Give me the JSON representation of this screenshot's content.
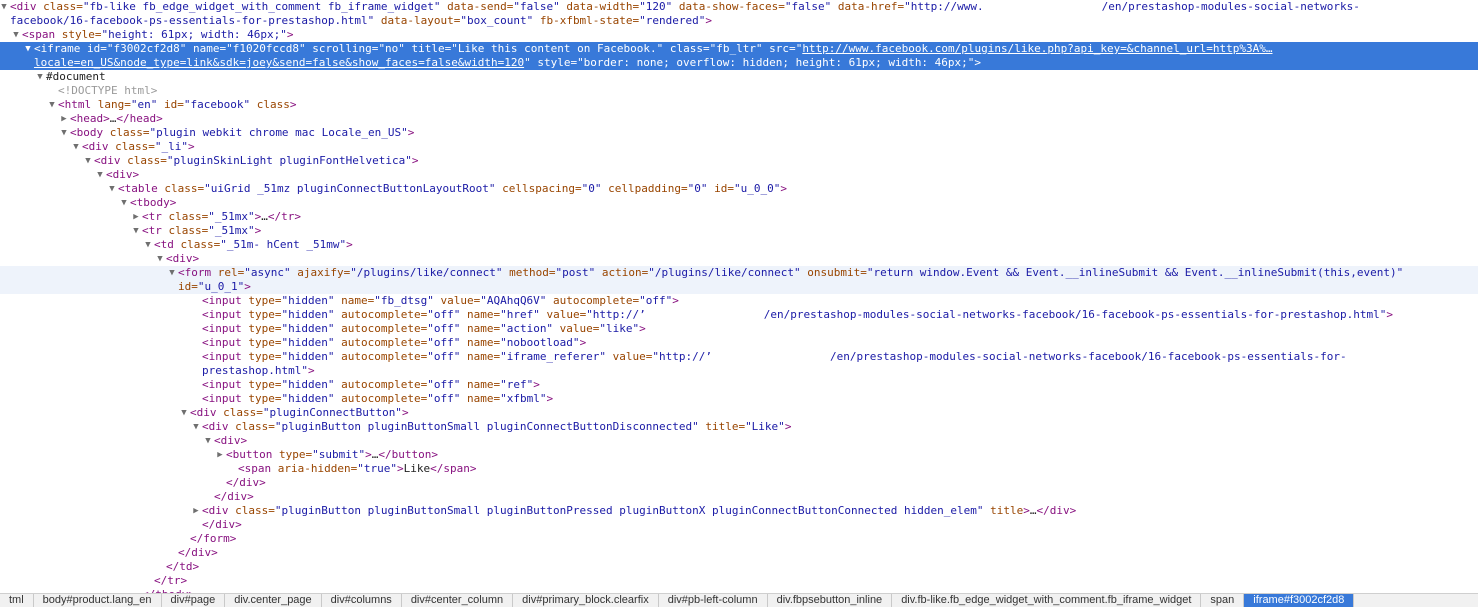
{
  "tree": [
    {
      "depth": 0,
      "tri": "▼",
      "wrap": true,
      "parts": [
        {
          "t": "<",
          "c": "tn"
        },
        {
          "t": "div",
          "c": "tn"
        },
        {
          "t": " class=",
          "c": "an"
        },
        {
          "t": "\"fb-like fb_edge_widget_with_comment fb_iframe_widget\"",
          "c": "av"
        },
        {
          "t": " data-send=",
          "c": "an"
        },
        {
          "t": "\"false\"",
          "c": "av"
        },
        {
          "t": " data-width=",
          "c": "an"
        },
        {
          "t": "\"120\"",
          "c": "av"
        },
        {
          "t": " data-show-faces=",
          "c": "an"
        },
        {
          "t": "\"false\"",
          "c": "av"
        },
        {
          "t": " data-href=",
          "c": "an"
        },
        {
          "t": "\"http://www.",
          "c": "av"
        },
        {
          "gap": 1
        },
        {
          "t": "/en/prestashop-modules-social-networks-facebook/16-facebook-ps-essentials-for-prestashop.html\"",
          "c": "av"
        },
        {
          "t": " data-layout=",
          "c": "an"
        },
        {
          "t": "\"box_count\"",
          "c": "av"
        },
        {
          "t": " fb-xfbml-state=",
          "c": "an"
        },
        {
          "t": "\"rendered\"",
          "c": "av"
        },
        {
          "t": ">",
          "c": "tn"
        }
      ]
    },
    {
      "depth": 1,
      "tri": "▼",
      "parts": [
        {
          "t": "<span",
          "c": "tn"
        },
        {
          "t": " style=",
          "c": "an"
        },
        {
          "t": "\"height: 61px; width: 46px;\"",
          "c": "av"
        },
        {
          "t": ">",
          "c": "tn"
        }
      ]
    },
    {
      "depth": 2,
      "tri": "▼",
      "selected": true,
      "wrap": true,
      "parts": [
        {
          "t": "<iframe",
          "c": "tn"
        },
        {
          "t": " id=",
          "c": "an"
        },
        {
          "t": "\"f3002cf2d8\"",
          "c": "av"
        },
        {
          "t": " name=",
          "c": "an"
        },
        {
          "t": "\"f1020fccd8\"",
          "c": "av"
        },
        {
          "t": " scrolling=",
          "c": "an"
        },
        {
          "t": "\"no\"",
          "c": "av"
        },
        {
          "t": " title=",
          "c": "an"
        },
        {
          "t": "\"Like this content on Facebook.\"",
          "c": "av"
        },
        {
          "t": " class=",
          "c": "an"
        },
        {
          "t": "\"fb_ltr\"",
          "c": "av"
        },
        {
          "t": " src=",
          "c": "an"
        },
        {
          "t": "\"",
          "c": "av"
        },
        {
          "t": "http://www.facebook.com/plugins/like.php?api_key=&channel_url=http%3A%… locale=en_US&node_type=link&sdk=joey&send=false&show_faces=false&width=120",
          "c": "av lnk"
        },
        {
          "t": "\"",
          "c": "av"
        },
        {
          "t": " style=",
          "c": "an"
        },
        {
          "t": "\"border: none; overflow: hidden; height: 61px; width: 46px;\"",
          "c": "av"
        },
        {
          "t": ">",
          "c": "tn"
        }
      ]
    },
    {
      "depth": 3,
      "tri": "▼",
      "parts": [
        {
          "t": "#document",
          "c": "tx"
        }
      ]
    },
    {
      "depth": 4,
      "tri": "",
      "parts": [
        {
          "t": "<!DOCTYPE html>",
          "c": "cm"
        }
      ]
    },
    {
      "depth": 4,
      "tri": "▼",
      "parts": [
        {
          "t": "<html",
          "c": "tn"
        },
        {
          "t": " lang=",
          "c": "an"
        },
        {
          "t": "\"en\"",
          "c": "av"
        },
        {
          "t": " id=",
          "c": "an"
        },
        {
          "t": "\"facebook\"",
          "c": "av"
        },
        {
          "t": " class",
          "c": "an"
        },
        {
          "t": ">",
          "c": "tn"
        }
      ]
    },
    {
      "depth": 5,
      "tri": "▶",
      "parts": [
        {
          "t": "<head>",
          "c": "tn"
        },
        {
          "t": "…",
          "c": "tx"
        },
        {
          "t": "</head>",
          "c": "tn"
        }
      ]
    },
    {
      "depth": 5,
      "tri": "▼",
      "parts": [
        {
          "t": "<body",
          "c": "tn"
        },
        {
          "t": " class=",
          "c": "an"
        },
        {
          "t": "\"plugin webkit chrome mac Locale_en_US\"",
          "c": "av"
        },
        {
          "t": ">",
          "c": "tn"
        }
      ]
    },
    {
      "depth": 6,
      "tri": "▼",
      "parts": [
        {
          "t": "<div",
          "c": "tn"
        },
        {
          "t": " class=",
          "c": "an"
        },
        {
          "t": "\"_li\"",
          "c": "av"
        },
        {
          "t": ">",
          "c": "tn"
        }
      ]
    },
    {
      "depth": 7,
      "tri": "▼",
      "parts": [
        {
          "t": "<div",
          "c": "tn"
        },
        {
          "t": " class=",
          "c": "an"
        },
        {
          "t": "\"pluginSkinLight pluginFontHelvetica\"",
          "c": "av"
        },
        {
          "t": ">",
          "c": "tn"
        }
      ]
    },
    {
      "depth": 8,
      "tri": "▼",
      "parts": [
        {
          "t": "<div>",
          "c": "tn"
        }
      ]
    },
    {
      "depth": 9,
      "tri": "▼",
      "parts": [
        {
          "t": "<table",
          "c": "tn"
        },
        {
          "t": " class=",
          "c": "an"
        },
        {
          "t": "\"uiGrid _51mz pluginConnectButtonLayoutRoot\"",
          "c": "av"
        },
        {
          "t": " cellspacing=",
          "c": "an"
        },
        {
          "t": "\"0\"",
          "c": "av"
        },
        {
          "t": " cellpadding=",
          "c": "an"
        },
        {
          "t": "\"0\"",
          "c": "av"
        },
        {
          "t": " id=",
          "c": "an"
        },
        {
          "t": "\"u_0_0\"",
          "c": "av"
        },
        {
          "t": ">",
          "c": "tn"
        }
      ]
    },
    {
      "depth": 10,
      "tri": "▼",
      "parts": [
        {
          "t": "<tbody>",
          "c": "tn"
        }
      ]
    },
    {
      "depth": 11,
      "tri": "▶",
      "parts": [
        {
          "t": "<tr",
          "c": "tn"
        },
        {
          "t": " class=",
          "c": "an"
        },
        {
          "t": "\"_51mx\"",
          "c": "av"
        },
        {
          "t": ">",
          "c": "tn"
        },
        {
          "t": "…",
          "c": "tx"
        },
        {
          "t": "</tr>",
          "c": "tn"
        }
      ]
    },
    {
      "depth": 11,
      "tri": "▼",
      "parts": [
        {
          "t": "<tr",
          "c": "tn"
        },
        {
          "t": " class=",
          "c": "an"
        },
        {
          "t": "\"_51mx\"",
          "c": "av"
        },
        {
          "t": ">",
          "c": "tn"
        }
      ]
    },
    {
      "depth": 12,
      "tri": "▼",
      "parts": [
        {
          "t": "<td",
          "c": "tn"
        },
        {
          "t": " class=",
          "c": "an"
        },
        {
          "t": "\"_51m- hCent _51mw\"",
          "c": "av"
        },
        {
          "t": ">",
          "c": "tn"
        }
      ]
    },
    {
      "depth": 13,
      "tri": "▼",
      "parts": [
        {
          "t": "<div>",
          "c": "tn"
        }
      ]
    },
    {
      "depth": 14,
      "tri": "▼",
      "hover": true,
      "wrap": true,
      "parts": [
        {
          "t": "<form",
          "c": "tn"
        },
        {
          "t": " rel=",
          "c": "an"
        },
        {
          "t": "\"async\"",
          "c": "av"
        },
        {
          "t": " ajaxify=",
          "c": "an"
        },
        {
          "t": "\"/plugins/like/connect\"",
          "c": "av"
        },
        {
          "t": " method=",
          "c": "an"
        },
        {
          "t": "\"post\"",
          "c": "av"
        },
        {
          "t": " action=",
          "c": "an"
        },
        {
          "t": "\"/plugins/like/connect\"",
          "c": "av"
        },
        {
          "t": " onsubmit=",
          "c": "an"
        },
        {
          "t": "\"return window.Event && Event.__inlineSubmit && Event.__inlineSubmit(this,event)\"",
          "c": "av"
        },
        {
          "t": " id=",
          "c": "an"
        },
        {
          "t": "\"u_0_1\"",
          "c": "av"
        },
        {
          "t": ">",
          "c": "tn"
        }
      ]
    },
    {
      "depth": 16,
      "tri": "",
      "parts": [
        {
          "t": "<input",
          "c": "tn"
        },
        {
          "t": " type=",
          "c": "an"
        },
        {
          "t": "\"hidden\"",
          "c": "av"
        },
        {
          "t": " name=",
          "c": "an"
        },
        {
          "t": "\"fb_dtsg\"",
          "c": "av"
        },
        {
          "t": " value=",
          "c": "an"
        },
        {
          "t": "\"AQAhqQ6V\"",
          "c": "av"
        },
        {
          "t": " autocomplete=",
          "c": "an"
        },
        {
          "t": "\"off\"",
          "c": "av"
        },
        {
          "t": ">",
          "c": "tn"
        }
      ]
    },
    {
      "depth": 16,
      "tri": "",
      "parts": [
        {
          "t": "<input",
          "c": "tn"
        },
        {
          "t": " type=",
          "c": "an"
        },
        {
          "t": "\"hidden\"",
          "c": "av"
        },
        {
          "t": " autocomplete=",
          "c": "an"
        },
        {
          "t": "\"off\"",
          "c": "av"
        },
        {
          "t": " name=",
          "c": "an"
        },
        {
          "t": "\"href\"",
          "c": "av"
        },
        {
          "t": " value=",
          "c": "an"
        },
        {
          "t": "\"http://’",
          "c": "av"
        },
        {
          "gap": 1
        },
        {
          "t": "/en/prestashop-modules-social-networks-facebook/16-facebook-ps-essentials-for-prestashop.html\"",
          "c": "av"
        },
        {
          "t": ">",
          "c": "tn"
        }
      ]
    },
    {
      "depth": 16,
      "tri": "",
      "parts": [
        {
          "t": "<input",
          "c": "tn"
        },
        {
          "t": " type=",
          "c": "an"
        },
        {
          "t": "\"hidden\"",
          "c": "av"
        },
        {
          "t": " autocomplete=",
          "c": "an"
        },
        {
          "t": "\"off\"",
          "c": "av"
        },
        {
          "t": " name=",
          "c": "an"
        },
        {
          "t": "\"action\"",
          "c": "av"
        },
        {
          "t": " value=",
          "c": "an"
        },
        {
          "t": "\"like\"",
          "c": "av"
        },
        {
          "t": ">",
          "c": "tn"
        }
      ]
    },
    {
      "depth": 16,
      "tri": "",
      "parts": [
        {
          "t": "<input",
          "c": "tn"
        },
        {
          "t": " type=",
          "c": "an"
        },
        {
          "t": "\"hidden\"",
          "c": "av"
        },
        {
          "t": " autocomplete=",
          "c": "an"
        },
        {
          "t": "\"off\"",
          "c": "av"
        },
        {
          "t": " name=",
          "c": "an"
        },
        {
          "t": "\"nobootload\"",
          "c": "av"
        },
        {
          "t": ">",
          "c": "tn"
        }
      ]
    },
    {
      "depth": 16,
      "tri": "",
      "wrap": true,
      "parts": [
        {
          "t": "<input",
          "c": "tn"
        },
        {
          "t": " type=",
          "c": "an"
        },
        {
          "t": "\"hidden\"",
          "c": "av"
        },
        {
          "t": " autocomplete=",
          "c": "an"
        },
        {
          "t": "\"off\"",
          "c": "av"
        },
        {
          "t": " name=",
          "c": "an"
        },
        {
          "t": "\"iframe_referer\"",
          "c": "av"
        },
        {
          "t": " value=",
          "c": "an"
        },
        {
          "t": "\"http://’",
          "c": "av"
        },
        {
          "gap": 1
        },
        {
          "t": "/en/prestashop-modules-social-networks-facebook/16-facebook-ps-essentials-for-prestashop.html\"",
          "c": "av"
        },
        {
          "t": ">",
          "c": "tn"
        }
      ]
    },
    {
      "depth": 16,
      "tri": "",
      "parts": [
        {
          "t": "<input",
          "c": "tn"
        },
        {
          "t": " type=",
          "c": "an"
        },
        {
          "t": "\"hidden\"",
          "c": "av"
        },
        {
          "t": " autocomplete=",
          "c": "an"
        },
        {
          "t": "\"off\"",
          "c": "av"
        },
        {
          "t": " name=",
          "c": "an"
        },
        {
          "t": "\"ref\"",
          "c": "av"
        },
        {
          "t": ">",
          "c": "tn"
        }
      ]
    },
    {
      "depth": 16,
      "tri": "",
      "parts": [
        {
          "t": "<input",
          "c": "tn"
        },
        {
          "t": " type=",
          "c": "an"
        },
        {
          "t": "\"hidden\"",
          "c": "av"
        },
        {
          "t": " autocomplete=",
          "c": "an"
        },
        {
          "t": "\"off\"",
          "c": "av"
        },
        {
          "t": " name=",
          "c": "an"
        },
        {
          "t": "\"xfbml\"",
          "c": "av"
        },
        {
          "t": ">",
          "c": "tn"
        }
      ]
    },
    {
      "depth": 15,
      "tri": "▼",
      "parts": [
        {
          "t": "<div",
          "c": "tn"
        },
        {
          "t": " class=",
          "c": "an"
        },
        {
          "t": "\"pluginConnectButton\"",
          "c": "av"
        },
        {
          "t": ">",
          "c": "tn"
        }
      ]
    },
    {
      "depth": 16,
      "tri": "▼",
      "parts": [
        {
          "t": "<div",
          "c": "tn"
        },
        {
          "t": " class=",
          "c": "an"
        },
        {
          "t": "\"pluginButton pluginButtonSmall pluginConnectButtonDisconnected\"",
          "c": "av"
        },
        {
          "t": " title=",
          "c": "an"
        },
        {
          "t": "\"Like\"",
          "c": "av"
        },
        {
          "t": ">",
          "c": "tn"
        }
      ]
    },
    {
      "depth": 17,
      "tri": "▼",
      "parts": [
        {
          "t": "<div>",
          "c": "tn"
        }
      ]
    },
    {
      "depth": 18,
      "tri": "▶",
      "parts": [
        {
          "t": "<button",
          "c": "tn"
        },
        {
          "t": " type=",
          "c": "an"
        },
        {
          "t": "\"submit\"",
          "c": "av"
        },
        {
          "t": ">",
          "c": "tn"
        },
        {
          "t": "…",
          "c": "tx"
        },
        {
          "t": "</button>",
          "c": "tn"
        }
      ]
    },
    {
      "depth": 19,
      "tri": "",
      "parts": [
        {
          "t": "<span",
          "c": "tn"
        },
        {
          "t": " aria-hidden=",
          "c": "an"
        },
        {
          "t": "\"true\"",
          "c": "av"
        },
        {
          "t": ">",
          "c": "tn"
        },
        {
          "t": "Like",
          "c": "tx"
        },
        {
          "t": "</span>",
          "c": "tn"
        }
      ]
    },
    {
      "depth": 18,
      "tri": "",
      "parts": [
        {
          "t": "</div>",
          "c": "tn"
        }
      ]
    },
    {
      "depth": 17,
      "tri": "",
      "parts": [
        {
          "t": "</div>",
          "c": "tn"
        }
      ]
    },
    {
      "depth": 16,
      "tri": "▶",
      "parts": [
        {
          "t": "<div",
          "c": "tn"
        },
        {
          "t": " class=",
          "c": "an"
        },
        {
          "t": "\"pluginButton pluginButtonSmall pluginButtonPressed pluginButtonX pluginConnectButtonConnected hidden_elem\"",
          "c": "av"
        },
        {
          "t": " title",
          "c": "an"
        },
        {
          "t": ">",
          "c": "tn"
        },
        {
          "t": "…",
          "c": "tx"
        },
        {
          "t": "</div>",
          "c": "tn"
        }
      ]
    },
    {
      "depth": 16,
      "tri": "",
      "parts": [
        {
          "t": "</div>",
          "c": "tn"
        }
      ]
    },
    {
      "depth": 15,
      "tri": "",
      "parts": [
        {
          "t": "</form>",
          "c": "tn"
        }
      ]
    },
    {
      "depth": 14,
      "tri": "",
      "parts": [
        {
          "t": "</div>",
          "c": "tn"
        }
      ]
    },
    {
      "depth": 13,
      "tri": "",
      "parts": [
        {
          "t": "</td>",
          "c": "tn"
        }
      ]
    },
    {
      "depth": 12,
      "tri": "",
      "parts": [
        {
          "t": "</tr>",
          "c": "tn"
        }
      ]
    },
    {
      "depth": 11,
      "tri": "",
      "parts": [
        {
          "t": "</tbody>",
          "c": "tn"
        }
      ]
    }
  ],
  "breadcrumbs": [
    {
      "label": "tml"
    },
    {
      "label": "body#product.lang_en"
    },
    {
      "label": "div#page"
    },
    {
      "label": "div.center_page"
    },
    {
      "label": "div#columns"
    },
    {
      "label": "div#center_column"
    },
    {
      "label": "div#primary_block.clearfix"
    },
    {
      "label": "div#pb-left-column"
    },
    {
      "label": "div.fbpsebutton_inline"
    },
    {
      "label": "div.fb-like.fb_edge_widget_with_comment.fb_iframe_widget"
    },
    {
      "label": "span"
    },
    {
      "label": "iframe#f3002cf2d8",
      "active": true
    }
  ]
}
